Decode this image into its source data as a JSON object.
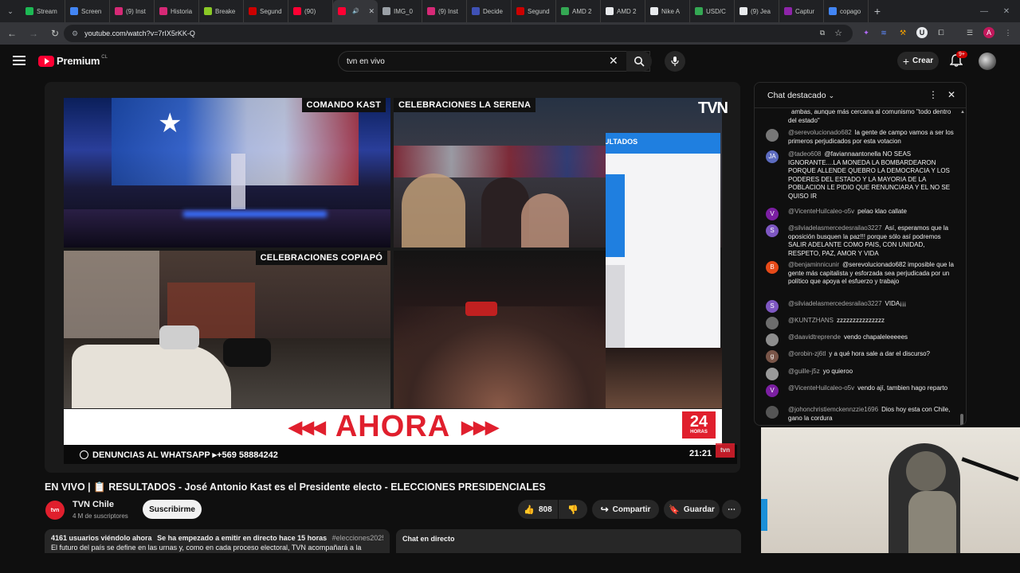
{
  "browser": {
    "tabs": [
      {
        "label": "Stream",
        "color": "#1db954"
      },
      {
        "label": "Screen",
        "color": "#4285f4"
      },
      {
        "label": "(9) Inst",
        "color": "#d62976"
      },
      {
        "label": "Historia",
        "color": "#d62976"
      },
      {
        "label": "Breake",
        "color": "#8ac926"
      },
      {
        "label": "Segund",
        "color": "#cc0000"
      },
      {
        "label": "(90)",
        "color": "#ff0033"
      },
      {
        "label": "",
        "color": "#ff0033"
      },
      {
        "label": "IMG_0",
        "color": "#9aa0a6"
      },
      {
        "label": "(9) Inst",
        "color": "#d62976"
      },
      {
        "label": "Decide",
        "color": "#3f51b5"
      },
      {
        "label": "Segund",
        "color": "#cc0000"
      },
      {
        "label": "AMD 2",
        "color": "#34a853"
      },
      {
        "label": "AMD 2",
        "color": "#e8eaed"
      },
      {
        "label": "Nike A",
        "color": "#e8eaed"
      },
      {
        "label": "USD/C",
        "color": "#34a853"
      },
      {
        "label": "(9) Jea",
        "color": "#e8eaed"
      },
      {
        "label": "Captur",
        "color": "#8e24aa"
      },
      {
        "label": "copago",
        "color": "#4285f4"
      }
    ],
    "url": "youtube.com/watch?v=7rIX5rKK-Q",
    "profile_initial": "A"
  },
  "youtube": {
    "logo_text": "Premium",
    "region": "CL",
    "search_value": "tvn en vivo",
    "create_label": "Crear",
    "notifications_badge": "9+"
  },
  "video": {
    "tile1_label": "COMANDO KAST",
    "tile2_label": "CELEBRACIONES LA SERENA",
    "tile3_label": "CELEBRACIONES COPIAPÓ",
    "results_label": "ULTADOS",
    "channel_logo": "TVN",
    "ahora": "AHORA",
    "badge_24": "24",
    "badge_horas": "HORAS",
    "ticker": "DENUNCIAS AL WHATSAPP ▸+569 58884242",
    "clock": "21:21",
    "watermark": "tvn"
  },
  "chat": {
    "header": "Chat destacado",
    "messages": [
      {
        "author": "",
        "text": "ambas, aunque más cercana al comunismo \"todo dentro del estado\"",
        "avatar": "",
        "color": "#0f0f0f"
      },
      {
        "author": "@serevolucionado682",
        "text": "la gente de campo vamos a ser los primeros perjudicados por esta votacion",
        "avatar": "",
        "color": "#777"
      },
      {
        "author": "@tadeo608",
        "text": "@faviannaantonella NO SEAS IGNORANTE....LA MONEDA LA BOMBARDEARON PORQUE ALLENDE QUEBRO LA DEMOCRACIA Y LOS PODERES DEL ESTADO Y LA MAYORIA DE LA POBLACION LE PIDIO QUE RENUNCIARA Y EL NO SE QUISO IR",
        "avatar": "JA",
        "color": "#5c6bc0"
      },
      {
        "author": "@VicenteHuilcaleo-o5v",
        "text": "pelao klao callate",
        "avatar": "V",
        "color": "#7b1fa2"
      },
      {
        "author": "@silviadelasmercedesrailao3227",
        "text": "Así, esperamos que la oposición busquen la paz!!! porque sólo así podremos SALIR ADELANTE COMO PAIS, CON UNIDAD, RESPETO, PAZ, AMOR Y VIDA",
        "avatar": "S",
        "color": "#7e57c2"
      },
      {
        "author": "@benjaminnicunir",
        "text": "@serevolucionado682 imposible que la gente más capitalista y esforzada sea perjudicada por un político que apoya el esfuerzo y trabajo",
        "avatar": "B",
        "color": "#e64a19"
      },
      {
        "author": "@silviadelasmercedesrailao3227",
        "text": "VIDA¡¡¡",
        "avatar": "S",
        "color": "#7e57c2"
      },
      {
        "author": "@KUNTZHANS",
        "text": "zzzzzzzzzzzzzzz",
        "avatar": "",
        "color": "#6d6d6d"
      },
      {
        "author": "@daavidtreprende",
        "text": "vendo chapaleleeeees",
        "avatar": "",
        "color": "#8d8d8d"
      },
      {
        "author": "@orobin-zj6tl",
        "text": "y a qué hora sale a dar el discurso?",
        "avatar": "g",
        "color": "#795548"
      },
      {
        "author": "@guille-j5z",
        "text": "yo quieroo",
        "avatar": "",
        "color": "#999"
      },
      {
        "author": "@VicenteHuilcaleo-o5v",
        "text": "vendo ají, tambien hago reparto",
        "avatar": "V",
        "color": "#7b1fa2"
      },
      {
        "author": "@johonchristiemckennzzie1696",
        "text": "Dios hoy esta con Chile, gano la cordura",
        "avatar": "",
        "color": "#555"
      }
    ]
  },
  "meta": {
    "title": "EN VIVO | 📋 RESULTADOS - José Antonio Kast es el Presidente electo - ELECCIONES PRESIDENCIALES",
    "channel_name": "TVN Chile",
    "channel_avatar": "tvn",
    "subscribers": "4 M de suscriptores",
    "subscribe_label": "Suscribirme",
    "likes": "808",
    "share_label": "Compartir",
    "save_label": "Guardar",
    "desc_line1_viewers": "4161 usuarios viéndolo ahora",
    "desc_line1_time": "Se ha empezado a emitir en directo hace 15 horas",
    "desc_line1_tag": "#elecciones2025",
    "desc_line2": "El futuro del país se define en las urnas y, como en cada proceso electoral, TVN acompañará a la",
    "chat_replay_label": "Chat en directo"
  },
  "colors": {
    "yt_red": "#ff0033",
    "tvn_red": "#e01f2d",
    "bg": "#0f0f0f"
  }
}
